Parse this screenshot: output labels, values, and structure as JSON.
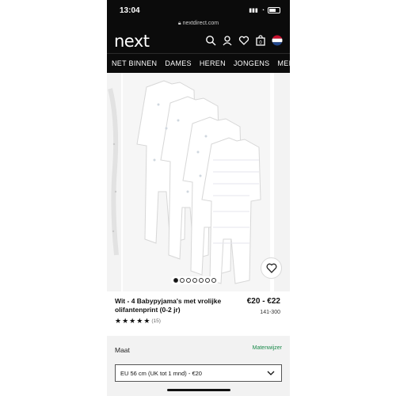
{
  "status": {
    "time": "13:04",
    "url": "nextdirect.com"
  },
  "header": {
    "logo": "next"
  },
  "nav": {
    "items": [
      "NET BINNEN",
      "DAMES",
      "HEREN",
      "JONGENS",
      "MEI"
    ]
  },
  "gallery": {
    "image_count": 7,
    "active_index": 0
  },
  "product": {
    "title": "Wit - 4 Babypyjama's met vrolijke olifantenprint (0-2 jr)",
    "price": "€20 - €22",
    "code": "141-300",
    "rating": 5,
    "review_count": "(15)"
  },
  "size": {
    "label": "Maat",
    "guide_link": "Matenwijzer",
    "selected": "EU 56 cm (UK tot 1 mnd) - €20"
  },
  "colors": {
    "bar_bg": "#0b0b0b",
    "link_green": "#1a8a4a",
    "panel_bg": "#f2f2f2"
  }
}
